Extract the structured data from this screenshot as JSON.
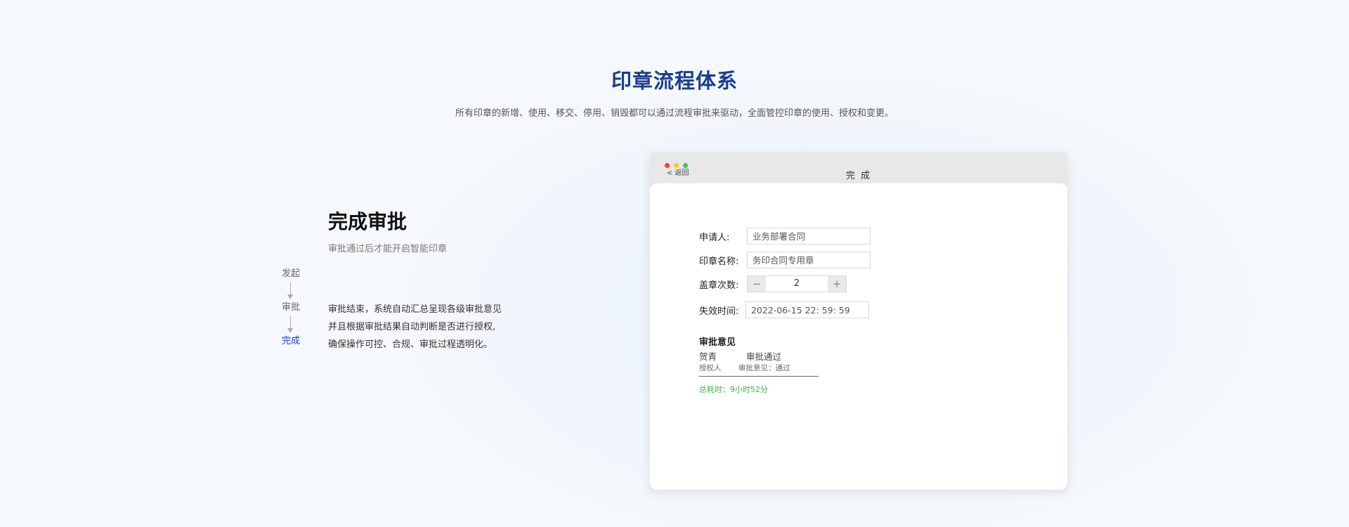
{
  "header": {
    "title": "印章流程体系",
    "subtitle": "所有印章的新增、使用、移交、停用、销毁都可以通过流程审批来驱动，全面管控印章的使用、授权和变更。"
  },
  "flow": {
    "steps": [
      "发起",
      "审批",
      "完成"
    ],
    "active_index": 2,
    "active_color": "#1f3fd0"
  },
  "section": {
    "heading": "完成审批",
    "subheading": "审批通过后才能开启智能印章",
    "description": [
      "审批结束，系统自动汇总呈现各级审批意见",
      "并且根据审批结果自动判断是否进行授权,",
      "确保操作可控、合规、审批过程透明化。"
    ]
  },
  "window": {
    "traffic_lights": [
      "#ff3b30",
      "#ffcc00",
      "#34c759"
    ],
    "back_label": "< 返回",
    "title": "完 成",
    "form": {
      "applicant_label": "申请人:",
      "applicant_value": "业务部署合同",
      "seal_name_label": "印章名称:",
      "seal_name_value": "务印合同专用章",
      "count_label": "盖章次数:",
      "count_value": "2",
      "minus": "−",
      "plus": "+",
      "expiry_label": "失效时间:",
      "expiry_value": "2022-06-15   22:  59:  59"
    },
    "opinion": {
      "title": "审批意见",
      "name": "贺青",
      "result": "审批通过",
      "role": "授权人",
      "comment": "审批意见：通过"
    },
    "duration": "总耗时：9小时52分",
    "duration_color": "#3bb54a"
  }
}
